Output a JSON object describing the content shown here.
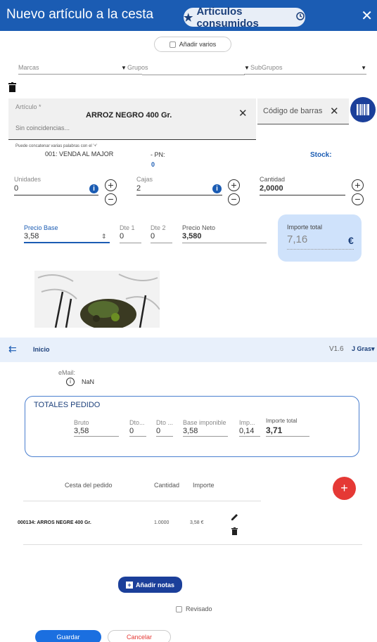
{
  "dialog": {
    "title": "Nuevo artículo a la cesta",
    "consumed_label": "Articulos consumidos",
    "close_glyph": "✕",
    "add_multiple_label": "Añadir varios",
    "filters": {
      "brands": "Marcas",
      "groups": "Grupos",
      "subgroups": "SubGrupos"
    },
    "article": {
      "label": "Artículo *",
      "value": "ARROZ NEGRO 400 Gr.",
      "no_match": "Sin coincidencias...",
      "barcode_placeholder": "Código de barras",
      "hint": "Puede concatenar varias palabras con el '+'",
      "warehouse": "001: VENDA AL MAJOR",
      "pn_label": "- PN:",
      "pn_value": "0",
      "stock_label": "Stock:"
    },
    "units": {
      "label": "Unidades",
      "value": "0"
    },
    "boxes": {
      "label": "Cajas",
      "value": "2"
    },
    "quantity": {
      "label": "Cantidad",
      "value": "2,0000"
    },
    "price": {
      "base_label": "Precio Base",
      "base_value": "3,58",
      "dte1_label": "Dte 1",
      "dte1_value": "0",
      "dte2_label": "Dte 2",
      "dte2_value": "0",
      "net_label": "Precio Neto",
      "net_value": "3,580",
      "total_label": "Importe total",
      "total_value": "7,16",
      "currency": "€"
    }
  },
  "appbar": {
    "back_label": "Inicio",
    "version": "V1.6",
    "user": "J Gras"
  },
  "order": {
    "email_label": "eMail:",
    "email_value": "NaN",
    "totals_title": "TOTALES PEDIDO",
    "totals": [
      {
        "label": "Bruto",
        "value": "3,58"
      },
      {
        "label": "Dto...",
        "value": "0"
      },
      {
        "label": "Dto ...",
        "value": "0"
      },
      {
        "label": "Base imponible",
        "value": "3,58"
      },
      {
        "label": "Imp...",
        "value": "0,14"
      },
      {
        "label": "Importe total",
        "value": "3,71"
      }
    ],
    "table_headers": {
      "item": "Cesta del pedido",
      "qty": "Cantidad",
      "amount": "Importe"
    },
    "rows": [
      {
        "item": "000134: ARROS NEGRE 400 Gr.",
        "qty": "1.0000",
        "amount": "3,58 €"
      }
    ],
    "add_notes_label": "Añadir notas",
    "reviewed_label": "Revisado",
    "save_label": "Guardar",
    "cancel_label": "Cancelar"
  },
  "colors": {
    "primary": "#1b5cb3",
    "fab": "#e53935",
    "total_bg": "#cfe2fb"
  }
}
